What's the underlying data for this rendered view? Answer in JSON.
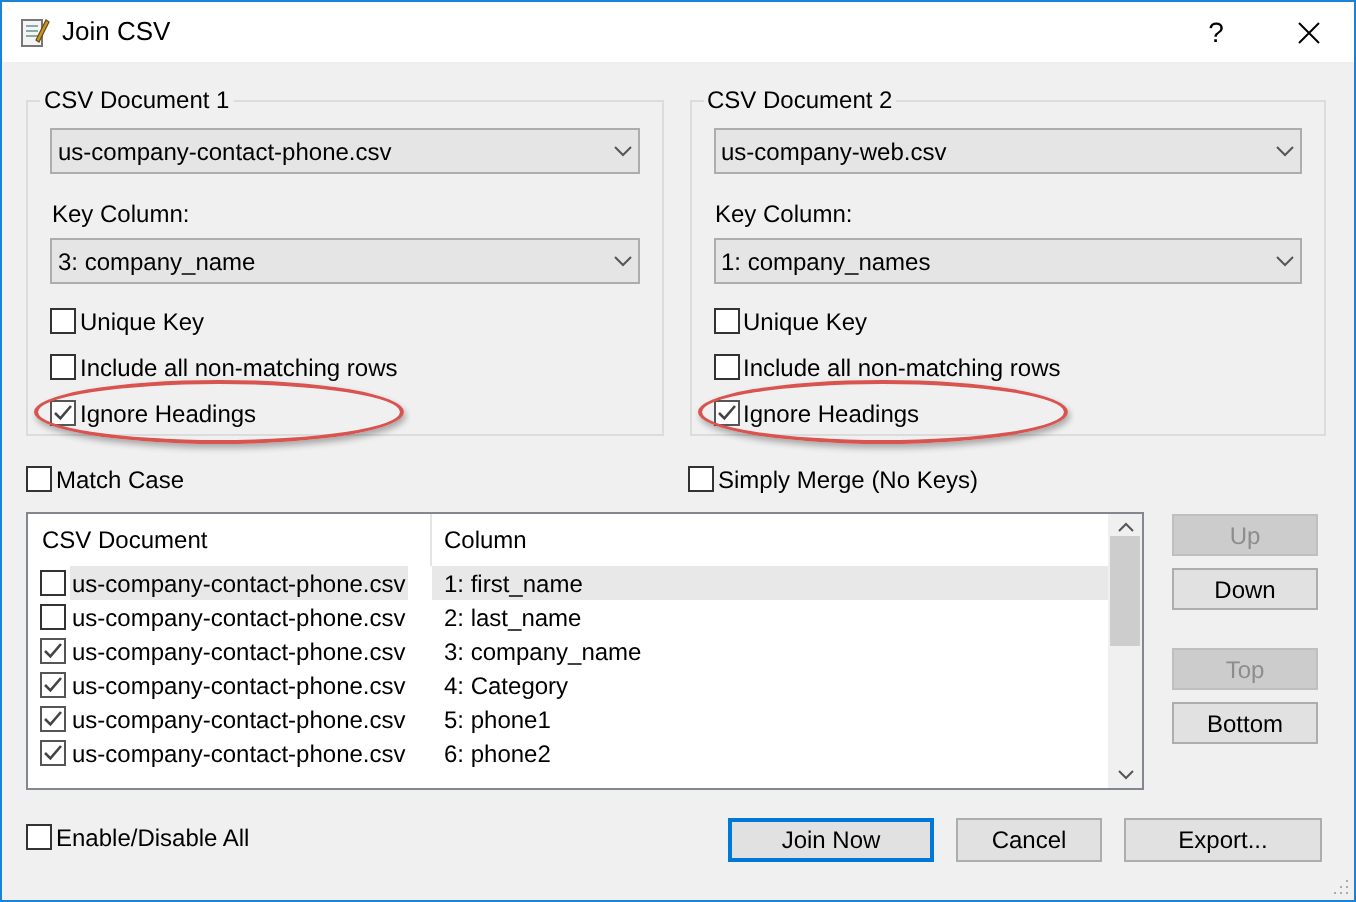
{
  "window": {
    "title": "Join CSV",
    "help": "?"
  },
  "documents": [
    {
      "title": "CSV Document 1",
      "file": "us-company-contact-phone.csv",
      "key_column_label": "Key Column:",
      "key_column": "3: company_name",
      "options": [
        {
          "label": "Unique Key",
          "checked": false,
          "highlighted": false
        },
        {
          "label": "Include all non-matching rows",
          "checked": false,
          "highlighted": false
        },
        {
          "label": "Ignore Headings",
          "checked": true,
          "highlighted": true
        }
      ]
    },
    {
      "title": "CSV Document 2",
      "file": "us-company-web.csv",
      "key_column_label": "Key Column:",
      "key_column": "1: company_names",
      "options": [
        {
          "label": "Unique Key",
          "checked": false,
          "highlighted": false
        },
        {
          "label": "Include all non-matching rows",
          "checked": false,
          "highlighted": false
        },
        {
          "label": "Ignore Headings",
          "checked": true,
          "highlighted": true
        }
      ]
    }
  ],
  "match_case": {
    "label": "Match Case",
    "checked": false
  },
  "simply_merge": {
    "label": "Simply Merge (No Keys)",
    "checked": false
  },
  "list": {
    "columns": [
      "CSV Document",
      "Column"
    ],
    "rows": [
      {
        "document": "us-company-contact-phone.csv",
        "column": "1: first_name",
        "checked": false,
        "selected": true
      },
      {
        "document": "us-company-contact-phone.csv",
        "column": "2: last_name",
        "checked": false,
        "selected": false
      },
      {
        "document": "us-company-contact-phone.csv",
        "column": "3: company_name",
        "checked": true,
        "selected": false
      },
      {
        "document": "us-company-contact-phone.csv",
        "column": "4: Category",
        "checked": true,
        "selected": false
      },
      {
        "document": "us-company-contact-phone.csv",
        "column": "5: phone1",
        "checked": true,
        "selected": false
      },
      {
        "document": "us-company-contact-phone.csv",
        "column": "6: phone2",
        "checked": true,
        "selected": false
      }
    ]
  },
  "side_buttons": [
    {
      "label": "Up",
      "disabled": true
    },
    {
      "label": "Down",
      "disabled": false
    },
    {
      "label": "Top",
      "disabled": true
    },
    {
      "label": "Bottom",
      "disabled": false
    }
  ],
  "enable_all": {
    "label": "Enable/Disable All",
    "checked": false
  },
  "buttons": [
    {
      "label": "Join Now",
      "default": true
    },
    {
      "label": "Cancel",
      "default": false
    },
    {
      "label": "Export...",
      "default": false
    }
  ]
}
